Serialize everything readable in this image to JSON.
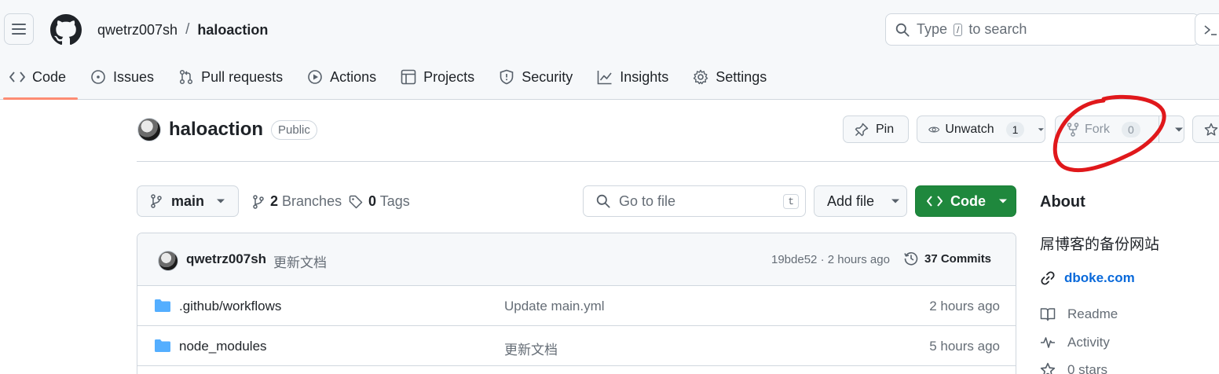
{
  "header": {
    "owner": "qwetrz007sh",
    "separator": "/",
    "repo": "haloaction",
    "search_prefix": "Type",
    "search_key": "/",
    "search_suffix": "to search"
  },
  "nav": {
    "tabs": [
      {
        "label": "Code",
        "icon": "code-icon",
        "active": true
      },
      {
        "label": "Issues",
        "icon": "issue-icon"
      },
      {
        "label": "Pull requests",
        "icon": "pull-request-icon"
      },
      {
        "label": "Actions",
        "icon": "play-icon"
      },
      {
        "label": "Projects",
        "icon": "table-icon"
      },
      {
        "label": "Security",
        "icon": "shield-icon"
      },
      {
        "label": "Insights",
        "icon": "graph-icon"
      },
      {
        "label": "Settings",
        "icon": "gear-icon"
      }
    ]
  },
  "repo": {
    "name": "haloaction",
    "visibility": "Public",
    "pin_label": "Pin",
    "watch_label": "Unwatch",
    "watch_count": "1",
    "fork_label": "Fork",
    "fork_count": "0"
  },
  "controls": {
    "branch": "main",
    "branches_count": "2",
    "branches_label": "Branches",
    "tags_count": "0",
    "tags_label": "Tags",
    "goto_placeholder": "Go to file",
    "goto_key": "t",
    "add_file_label": "Add file",
    "code_label": "Code"
  },
  "latest_commit": {
    "author": "qwetrz007sh",
    "message": "更新文档",
    "sha_time": "19bde52 · 2 hours ago",
    "commits": "37 Commits"
  },
  "files": [
    {
      "name": ".github/workflows",
      "message": "Update main.yml",
      "age": "2 hours ago",
      "type": "folder"
    },
    {
      "name": "node_modules",
      "message": "更新文档",
      "age": "5 hours ago",
      "type": "folder"
    }
  ],
  "about": {
    "heading": "About",
    "description": "屌博客的备份网站",
    "link": "dboke.com",
    "readme": "Readme",
    "activity": "Activity",
    "stars": "0 stars"
  },
  "colors": {
    "accent_underline": "#fd8c73",
    "code_button": "#1f883d",
    "link": "#0969da",
    "annotation": "#e0181b",
    "folder": "#54aeff"
  }
}
